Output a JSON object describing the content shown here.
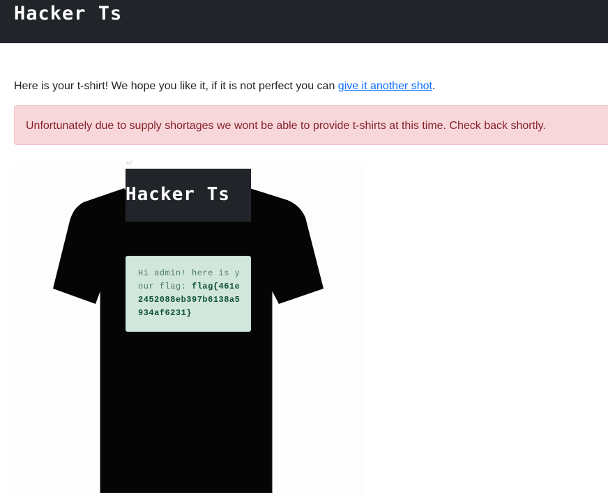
{
  "navbar": {
    "brand": "Hacker Ts"
  },
  "intro": {
    "text": "Here is your t-shirt! We hope you like it, if it is not perfect you can ",
    "link_label": "give it another shot",
    "suffix": "."
  },
  "alert": {
    "message": "Unfortunately due to supply shortages we wont be able to provide t-shirts at this time. Check back shortly."
  },
  "tshirt": {
    "mark": "«/",
    "print_brand": "Hacker Ts",
    "greeting": "Hi admin! here is your flag: ",
    "flag": "flag{461e2452088eb397b6138a5934af6231}",
    "shirt_color": "#050505"
  },
  "colors": {
    "navbar_bg": "#212529",
    "alert_bg": "#f8d7da",
    "alert_text": "#842029",
    "link": "#0d6efd",
    "card_bg": "#d1e7dd"
  }
}
